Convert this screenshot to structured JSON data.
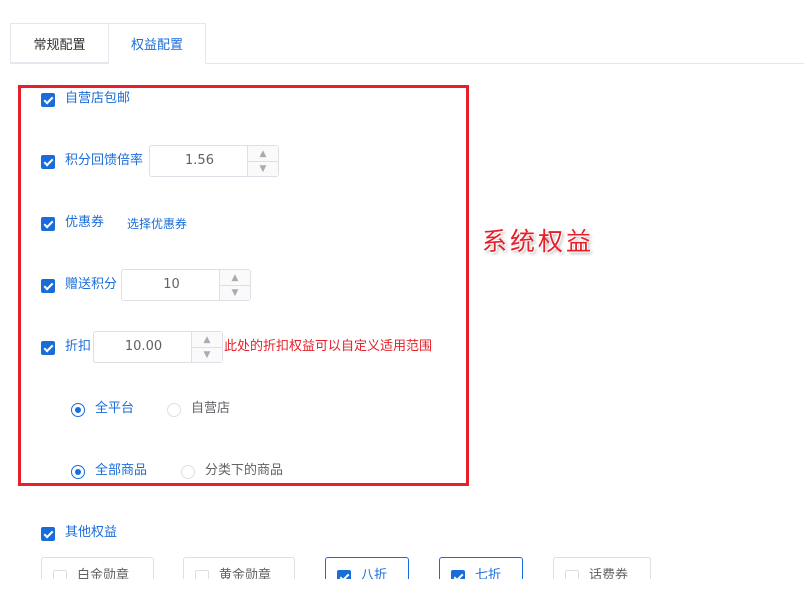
{
  "tabs": [
    {
      "label": "常规配置",
      "active": false
    },
    {
      "label": "权益配置",
      "active": true
    }
  ],
  "benefits": {
    "free_shipping": {
      "label": "自营店包邮",
      "checked": true
    },
    "points_rate": {
      "label": "积分回馈倍率",
      "checked": true,
      "value": "1.56"
    },
    "coupon": {
      "label": "优惠券",
      "checked": true,
      "link": "选择优惠券"
    },
    "gift_points": {
      "label": "赠送积分",
      "checked": true,
      "value": "10"
    },
    "discount": {
      "label": "折扣",
      "checked": true,
      "value": "10.00",
      "note": "此处的折扣权益可以自定义适用范围"
    },
    "scope_platform": {
      "options": [
        "全平台",
        "自营店"
      ],
      "selected": "全平台"
    },
    "scope_goods": {
      "options": [
        "全部商品",
        "分类下的商品"
      ],
      "selected": "全部商品"
    }
  },
  "annotation": "系统权益",
  "other": {
    "label": "其他权益",
    "checked": true,
    "chips": [
      {
        "label": "白金勋章",
        "checked": false
      },
      {
        "label": "黄金勋章",
        "checked": false
      },
      {
        "label": "八折",
        "checked": true
      },
      {
        "label": "七折",
        "checked": true
      },
      {
        "label": "话费券",
        "checked": false
      }
    ]
  },
  "colors": {
    "primary": "#1a6dd9",
    "highlight": "#e5202a",
    "border": "#dcdfe6"
  }
}
